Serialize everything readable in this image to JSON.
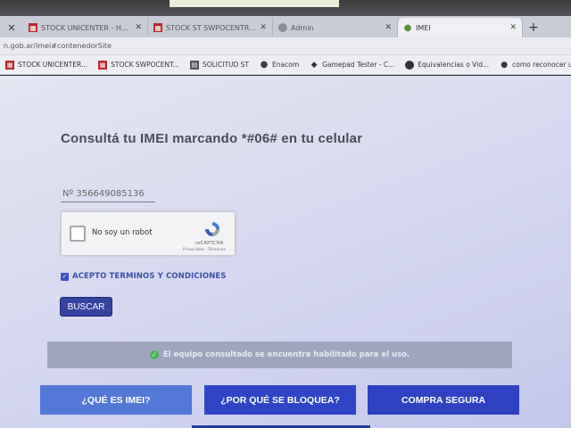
{
  "browser": {
    "tabs": [
      {
        "label": "STOCK UNICENTER - Hoja d",
        "icon": "sheets-icon"
      },
      {
        "label": "STOCK ST SWPOCENTRAL - ",
        "icon": "sheets-icon"
      },
      {
        "label": "Admin",
        "icon": "globe-icon"
      },
      {
        "label": "IMEI",
        "icon": "enacom-drop-icon",
        "active": true
      }
    ],
    "address": "n.gob.ar/imei#contenedorSite",
    "bookmarks": [
      {
        "label": "STOCK UNICENTER...",
        "icon": "sheets-icon"
      },
      {
        "label": "STOCK SWPOCENT...",
        "icon": "sheets-icon"
      },
      {
        "label": "SOLICITUD ST",
        "icon": "doc-icon"
      },
      {
        "label": "Enacom",
        "icon": "enacom-drop-icon"
      },
      {
        "label": "Gamepad Tester - C...",
        "icon": "gamepad-icon"
      },
      {
        "label": "Equivalencias o Vid...",
        "icon": "globe-icon"
      },
      {
        "label": "como reconocer un...",
        "icon": "apple-icon"
      }
    ]
  },
  "page": {
    "title": "Consultá tu IMEI marcando *#06# en tu celular",
    "imei_value": "Nº 356649085136",
    "captcha": {
      "label": "No soy un robot",
      "brand": "reCAPTCHA",
      "links": "Privacidad - Términos"
    },
    "terms_label": "ACEPTO TERMINOS Y CONDICIONES",
    "search_button": "BUSCAR",
    "result_message": "El equipo consultado se encuentra habilitado para el uso.",
    "bottom_buttons": {
      "what_is": "¿QUÉ ES IMEI?",
      "why_blocked": "¿POR QUÉ SE BLOQUEA?",
      "safe_purchase": "COMPRA SEGURA"
    }
  },
  "colors": {
    "accent": "#3644a0",
    "success": "#4ab25a",
    "result_bg": "#9ea6bf"
  }
}
